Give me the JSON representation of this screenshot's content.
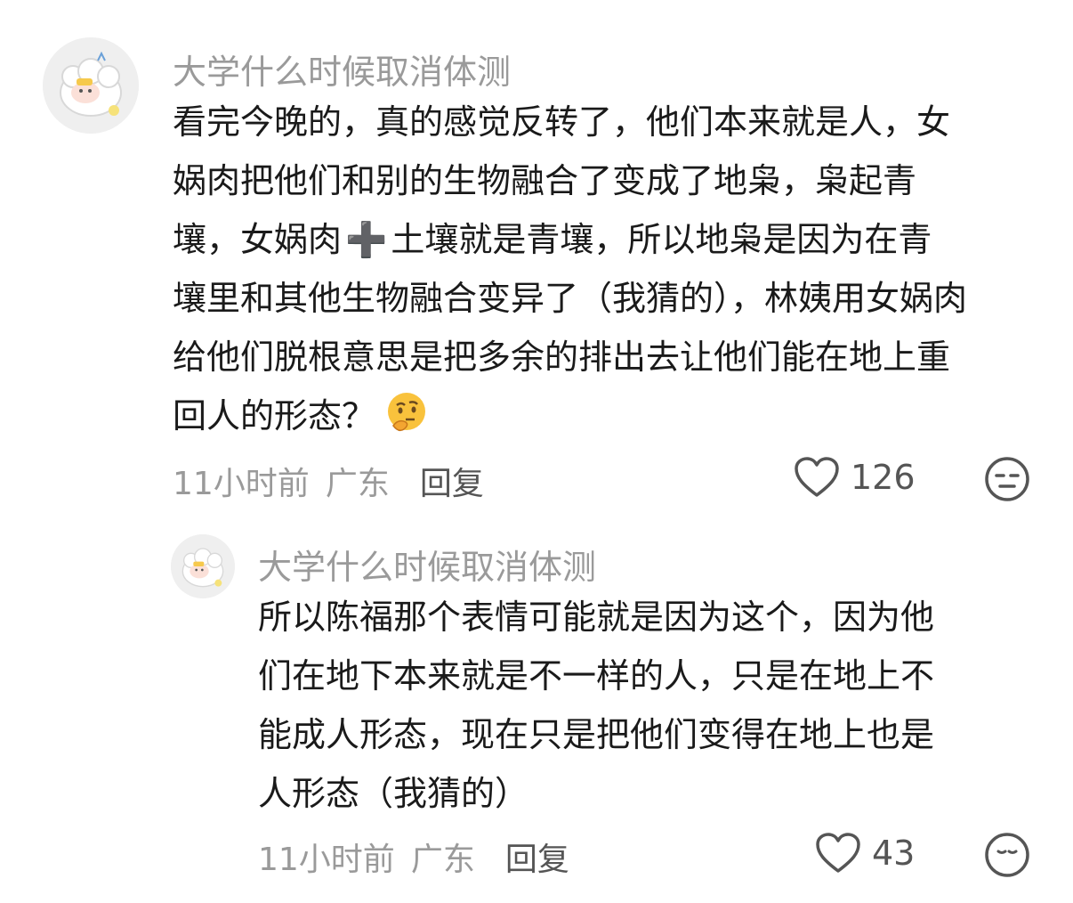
{
  "comments": [
    {
      "username": "大学什么时候取消体测",
      "lines": [
        "看完今晚的，真的感觉反转了，他们本来就是人，女",
        "娲肉把他们和别的生物融合了变成了地枭，枭起青",
        "壤，女娲肉",
        "土壤就是青壤，所以地枭是因为在青",
        "壤里和其他生物融合变异了（我猜的），林姨用女娲肉",
        "给他们脱根意思是把多余的排出去让他们能在地上重",
        "回人的形态？"
      ],
      "plus_symbol": "➕",
      "time": "11小时前",
      "location": "广东",
      "reply_label": "回复",
      "likes": "126"
    },
    {
      "username": "大学什么时候取消体测",
      "lines": [
        "所以陈福那个表情可能就是因为这个，因为他",
        "们在地下本来就是不一样的人，只是在地上不",
        "能成人形态，现在只是把他们变得在地上也是",
        "人形态（我猜的）"
      ],
      "time": "11小时前",
      "location": "广东",
      "reply_label": "回复",
      "likes": "43"
    }
  ],
  "icons": {
    "like": "heart-outline-icon",
    "dislike": "neutral-face-icon",
    "emoji": "thinking-face-emoji"
  },
  "colors": {
    "text": "#1a1a1a",
    "muted": "#9a9a9a",
    "icon": "#555555"
  }
}
